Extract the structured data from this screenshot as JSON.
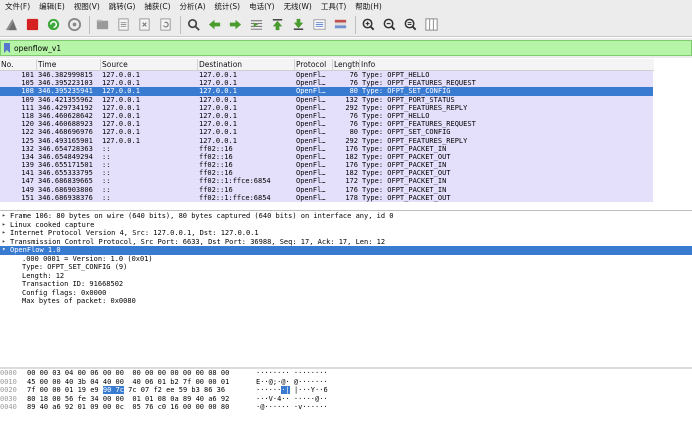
{
  "menu": [
    "文件(F)",
    "编辑(E)",
    "视图(V)",
    "跳转(G)",
    "捕获(C)",
    "分析(A)",
    "统计(S)",
    "电话(Y)",
    "无线(W)",
    "工具(T)",
    "帮助(H)"
  ],
  "toolbar_icons": [
    "shark-fin-start-icon",
    "stop-capture-icon",
    "restart-capture-icon",
    "capture-options-icon",
    "open-file-icon",
    "save-file-icon",
    "close-file-icon",
    "reload-file-icon",
    "find-packet-icon",
    "go-back-icon",
    "go-forward-icon",
    "go-to-packet-icon",
    "go-first-icon",
    "go-last-icon",
    "autoscroll-icon",
    "colorize-icon",
    "zoom-in-icon",
    "zoom-out-icon",
    "zoom-normal-icon",
    "resize-columns-icon"
  ],
  "filter": {
    "value": "openflow_v1"
  },
  "columns": [
    "No.",
    "Time",
    "Source",
    "Destination",
    "Protocol",
    "Length",
    "Info"
  ],
  "packets": [
    {
      "no": "101",
      "time": "346.382999815",
      "src": "127.0.0.1",
      "dst": "127.0.0.1",
      "proto": "OpenFl…",
      "len": "76",
      "info": "Type: OFPT_HELLO",
      "kind": "tcp"
    },
    {
      "no": "105",
      "time": "346.395223103",
      "src": "127.0.0.1",
      "dst": "127.0.0.1",
      "proto": "OpenFl…",
      "len": "76",
      "info": "Type: OFPT_FEATURES_REQUEST",
      "kind": "tcp"
    },
    {
      "no": "108",
      "time": "346.395235941",
      "src": "127.0.0.1",
      "dst": "127.0.0.1",
      "proto": "OpenFl…",
      "len": "80",
      "info": "Type: OFPT_SET_CONFIG",
      "kind": "sel"
    },
    {
      "no": "109",
      "time": "346.421355962",
      "src": "127.0.0.1",
      "dst": "127.0.0.1",
      "proto": "OpenFl…",
      "len": "132",
      "info": "Type: OFPT_PORT_STATUS",
      "kind": "tcp"
    },
    {
      "no": "111",
      "time": "346.429734192",
      "src": "127.0.0.1",
      "dst": "127.0.0.1",
      "proto": "OpenFl…",
      "len": "292",
      "info": "Type: OFPT_FEATURES_REPLY",
      "kind": "tcp"
    },
    {
      "no": "118",
      "time": "346.460628642",
      "src": "127.0.0.1",
      "dst": "127.0.0.1",
      "proto": "OpenFl…",
      "len": "76",
      "info": "Type: OFPT_HELLO",
      "kind": "tcp"
    },
    {
      "no": "120",
      "time": "346.460688923",
      "src": "127.0.0.1",
      "dst": "127.0.0.1",
      "proto": "OpenFl…",
      "len": "76",
      "info": "Type: OFPT_FEATURES_REQUEST",
      "kind": "tcp"
    },
    {
      "no": "122",
      "time": "346.468696976",
      "src": "127.0.0.1",
      "dst": "127.0.0.1",
      "proto": "OpenFl…",
      "len": "80",
      "info": "Type: OFPT_SET_CONFIG",
      "kind": "tcp"
    },
    {
      "no": "125",
      "time": "346.493165901",
      "src": "127.0.0.1",
      "dst": "127.0.0.1",
      "proto": "OpenFl…",
      "len": "292",
      "info": "Type: OFPT_FEATURES_REPLY",
      "kind": "tcp"
    },
    {
      "no": "132",
      "time": "346.654728363",
      "src": "::",
      "dst": "ff02::16",
      "proto": "OpenFl…",
      "len": "176",
      "info": "Type: OFPT_PACKET_IN",
      "kind": "tcp"
    },
    {
      "no": "134",
      "time": "346.654849294",
      "src": "::",
      "dst": "ff02::16",
      "proto": "OpenFl…",
      "len": "182",
      "info": "Type: OFPT_PACKET_OUT",
      "kind": "tcp"
    },
    {
      "no": "139",
      "time": "346.655171501",
      "src": "::",
      "dst": "ff02::16",
      "proto": "OpenFl…",
      "len": "176",
      "info": "Type: OFPT_PACKET_IN",
      "kind": "tcp"
    },
    {
      "no": "141",
      "time": "346.655333795",
      "src": "::",
      "dst": "ff02::16",
      "proto": "OpenFl…",
      "len": "182",
      "info": "Type: OFPT_PACKET_OUT",
      "kind": "tcp"
    },
    {
      "no": "147",
      "time": "346.686839665",
      "src": "::",
      "dst": "ff02::1:ffce:6854",
      "proto": "OpenFl…",
      "len": "172",
      "info": "Type: OFPT_PACKET_IN",
      "kind": "tcp"
    },
    {
      "no": "149",
      "time": "346.686903806",
      "src": "::",
      "dst": "ff02::16",
      "proto": "OpenFl…",
      "len": "176",
      "info": "Type: OFPT_PACKET_IN",
      "kind": "tcp"
    },
    {
      "no": "151",
      "time": "346.686938376",
      "src": "::",
      "dst": "ff02::1:ffce:6854",
      "proto": "OpenFl…",
      "len": "178",
      "info": "Type: OFPT_PACKET_OUT",
      "kind": "tcp"
    }
  ],
  "details": [
    {
      "text": "Frame 106: 80 bytes on wire (640 bits), 80 bytes captured (640 bits) on interface any, id 0",
      "arrow": "▸",
      "level": 0,
      "hl": false
    },
    {
      "text": "Linux cooked capture",
      "arrow": "▸",
      "level": 0,
      "hl": false
    },
    {
      "text": "Internet Protocol Version 4, Src: 127.0.0.1, Dst: 127.0.0.1",
      "arrow": "▸",
      "level": 0,
      "hl": false
    },
    {
      "text": "Transmission Control Protocol, Src Port: 6633, Dst Port: 36988, Seq: 17, Ack: 17, Len: 12",
      "arrow": "▸",
      "level": 0,
      "hl": false
    },
    {
      "text": "OpenFlow 1.0",
      "arrow": "▾",
      "level": 0,
      "hl": true
    },
    {
      "text": ".000 0001 = Version: 1.0 (0x01)",
      "arrow": "",
      "level": 1,
      "hl": false
    },
    {
      "text": "Type: OFPT_SET_CONFIG (9)",
      "arrow": "",
      "level": 1,
      "hl": false
    },
    {
      "text": "Length: 12",
      "arrow": "",
      "level": 1,
      "hl": false
    },
    {
      "text": "Transaction ID: 91668502",
      "arrow": "",
      "level": 1,
      "hl": false
    },
    {
      "text": "Config flags: 0x0000",
      "arrow": "",
      "level": 1,
      "hl": false
    },
    {
      "text": "Max bytes of packet: 0x0080",
      "arrow": "",
      "level": 1,
      "hl": false
    }
  ],
  "bytes": [
    {
      "off": "0000",
      "pre": "00 00 03 04 00 06 00 00  00 00 00 00 00 00 08 00",
      "hl": "",
      "post": "",
      "apre": "········ ········",
      "ahl": "",
      "apost": ""
    },
    {
      "off": "0010",
      "pre": "45 00 00 40 3b 04 40 00  40 06 01 b2 7f 00 00 01",
      "hl": "",
      "post": "",
      "apre": "E··@;·@· @·······",
      "ahl": "",
      "apost": ""
    },
    {
      "off": "0020",
      "pre": "7f 00 00 01 19 e9 ",
      "hl": "90 7c",
      "post": " 7c 07 f2 ee 59 b3 86 36",
      "apre": "······",
      "ahl": "·|",
      "apost": " |···Y··6"
    },
    {
      "off": "0030",
      "pre": "80 18 00 56 fe 34 00 00  01 01 08 0a 89 40 a6 92",
      "hl": "",
      "post": "",
      "apre": "···V·4·· ·····@··",
      "ahl": "",
      "apost": ""
    },
    {
      "off": "0040",
      "pre": "89 40 a6 92 01 09 00 0c  05 76 c0 16 00 00 00 80",
      "hl": "",
      "post": "",
      "apre": "·@······ ·v······",
      "ahl": "",
      "apost": ""
    }
  ]
}
